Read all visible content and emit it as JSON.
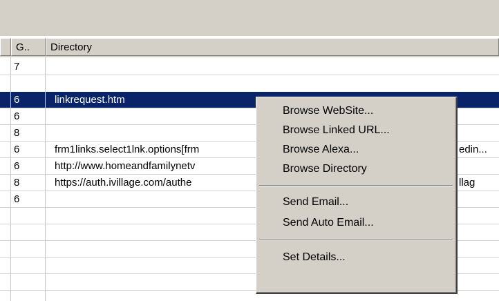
{
  "grid": {
    "columns": [
      "G..",
      "Directory"
    ],
    "rows": [
      {
        "g": "7",
        "directory": ""
      },
      {
        "g": "6",
        "directory": "linkrequest.htm"
      },
      {
        "g": "6",
        "directory": ""
      },
      {
        "g": "8",
        "directory": ""
      },
      {
        "g": "6",
        "directory": "frm1links.select1lnk.options[frm"
      },
      {
        "g": "6",
        "directory": "http://www.homeandfamilynetv"
      },
      {
        "g": "8",
        "directory": "https://auth.ivillage.com/authe"
      },
      {
        "g": "6",
        "directory": ""
      }
    ],
    "partial_text": {
      "row5_right": "edin...",
      "row7_right": "llag"
    }
  },
  "context_menu": {
    "items": [
      "Browse WebSite...",
      "Browse Linked URL...",
      "Browse Alexa...",
      "Browse Directory",
      "Send Email...",
      "Send Auto Email...",
      "Set Details..."
    ]
  },
  "colors": {
    "selection": "#0a246a",
    "chrome": "#d4d0c8"
  }
}
